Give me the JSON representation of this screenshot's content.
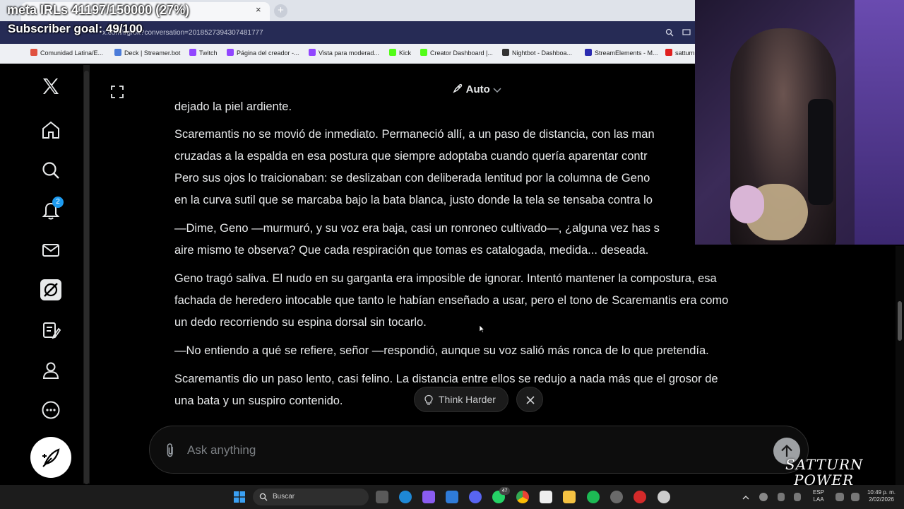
{
  "overlay": {
    "meta_text": "meta IRLs 41197/150000 (27%)",
    "goal_text": "Subscriber goal: 49/100"
  },
  "browser": {
    "tab_close": "×",
    "new_tab": "+",
    "address": "x.com/i/grok?conversation=2018527394307481777",
    "bookmarks": [
      {
        "label": "Comunidad Latina/E...",
        "color": "#e0513f"
      },
      {
        "label": "Deck | Streamer.bot",
        "color": "#4b7bd9"
      },
      {
        "label": "Twitch",
        "color": "#9146ff"
      },
      {
        "label": "Página del creador -...",
        "color": "#9146ff"
      },
      {
        "label": "Vista para moderad...",
        "color": "#9146ff"
      },
      {
        "label": "Kick",
        "color": "#53fc18"
      },
      {
        "label": "Creator Dashboard |...",
        "color": "#53fc18"
      },
      {
        "label": "Nightbot - Dashboa...",
        "color": "#333333"
      },
      {
        "label": "StreamElements - M...",
        "color": "#2b2bb0"
      },
      {
        "label": "satturn",
        "color": "#e0201f"
      }
    ]
  },
  "sidebar": {
    "notification_count": "2",
    "items": [
      "x-logo",
      "home",
      "explore",
      "notifications",
      "messages",
      "grok",
      "lists",
      "profile",
      "more",
      "post"
    ]
  },
  "header": {
    "model_label": "Auto"
  },
  "conversation": {
    "paragraphs": [
      "dejado la piel ardiente.",
      "Scaremantis no se movió de inmediato. Permaneció allí, a un paso de distancia, con las man",
      "cruzadas a la espalda en esa postura que siempre adoptaba cuando quería aparentar contr",
      "Pero sus ojos lo traicionaban: se deslizaban con deliberada lentitud por la columna de Geno",
      "en la curva sutil que se marcaba bajo la bata blanca, justo donde la tela se tensaba contra lo",
      "—Dime, Geno —murmuró, y su voz era baja, casi un ronroneo cultivado—, ¿alguna vez has s",
      "aire mismo te observa? Que cada respiración que tomas es catalogada, medida... deseada.",
      "Geno tragó saliva. El nudo en su garganta era imposible de ignorar. Intentó mantener la compostura, esa",
      "fachada de heredero intocable que tanto le habían enseñado a usar, pero el tono de Scaremantis era como",
      "un dedo recorriendo su espina dorsal sin tocarlo.",
      "—No entiendo a qué se refiere, señor —respondió, aunque su voz salió más ronca de lo que pretendía.",
      "Scaremantis dio un paso lento, casi felino. La distancia entre ellos se redujo a nada más que el grosor de",
      "una bata y un suspiro contenido."
    ]
  },
  "actions": {
    "think_harder": "Think Harder"
  },
  "composer": {
    "placeholder": "Ask anything"
  },
  "taskbar": {
    "search_label": "Buscar",
    "whatsapp_badge": "47",
    "lang_top": "ESP",
    "lang_bottom": "LAA",
    "time": "10:49 p. m.",
    "date": "2/02/2026"
  },
  "logo": {
    "line1": "SATTURN",
    "line2": "POWER"
  },
  "colors": {
    "accent": "#1d9bf0",
    "background": "#000000",
    "text": "#e7e9ea"
  }
}
